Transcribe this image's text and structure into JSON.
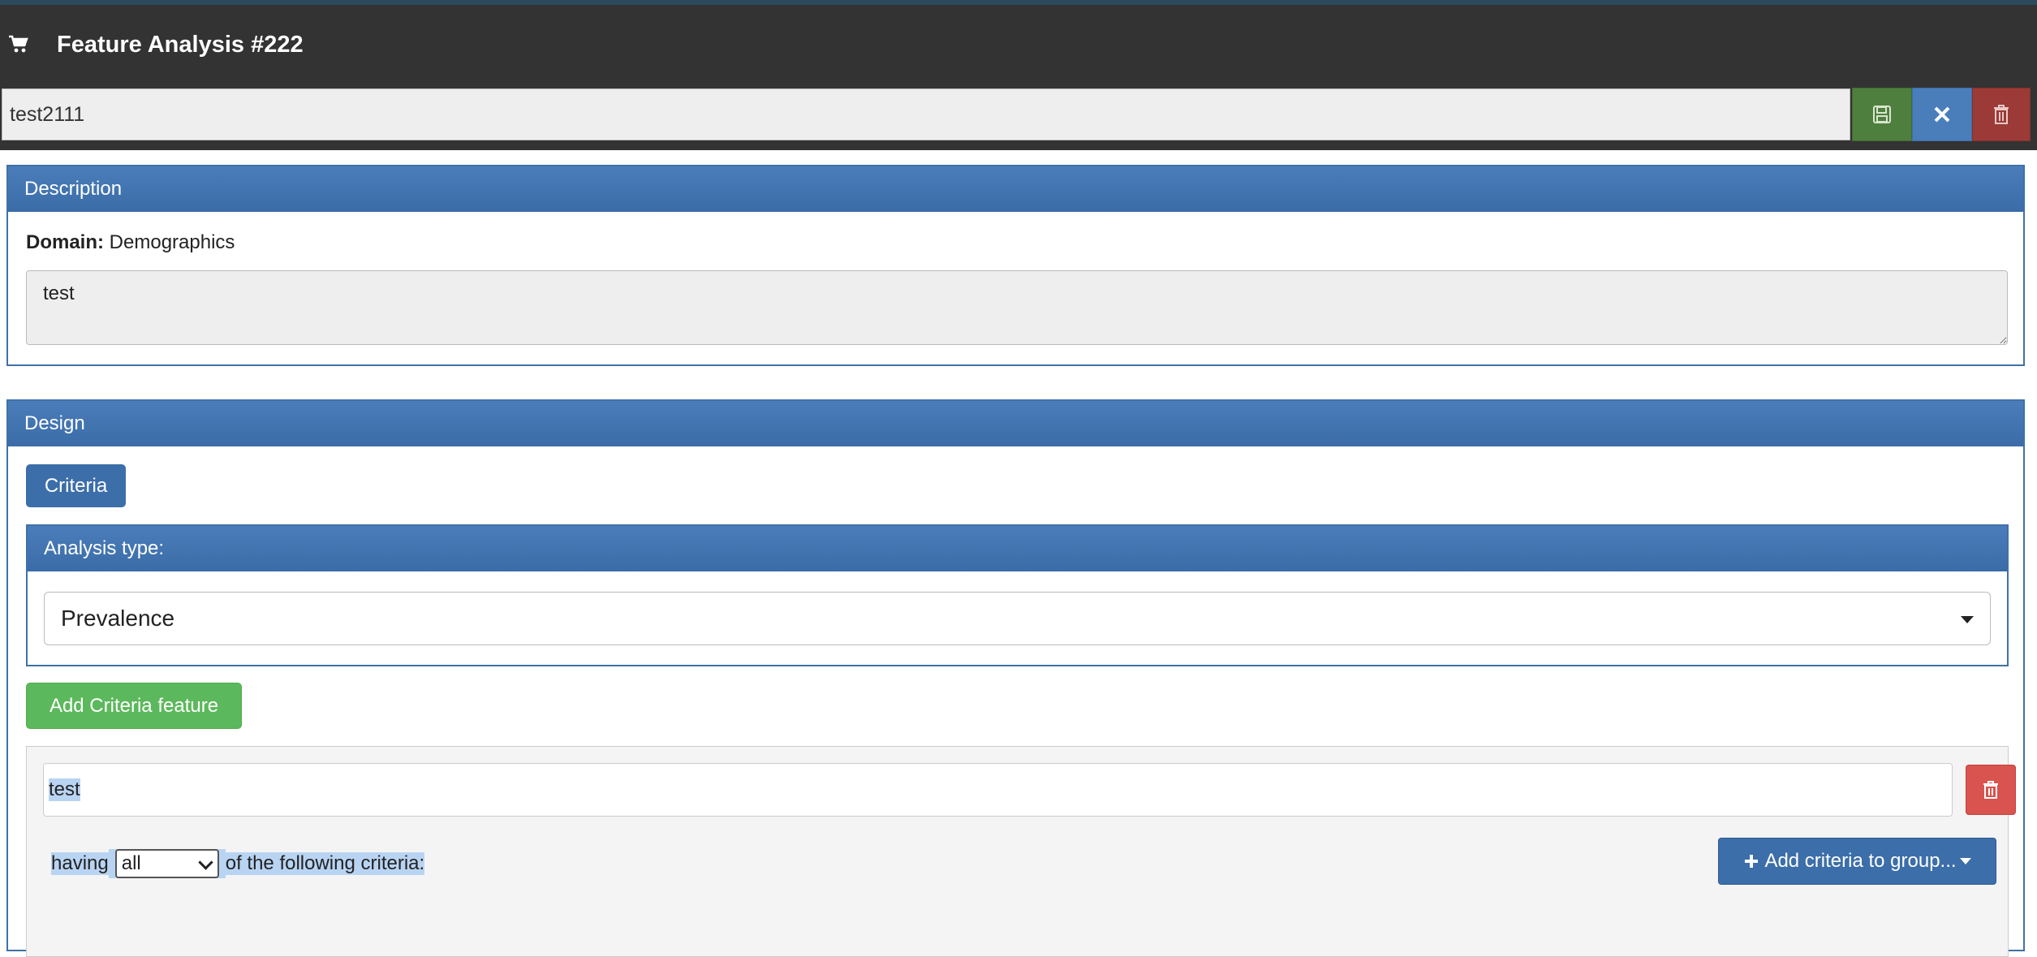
{
  "header": {
    "title": "Feature Analysis #222",
    "name_value": "test2111",
    "save_label": "save",
    "close_label": "close",
    "delete_label": "delete"
  },
  "description": {
    "heading": "Description",
    "domain_label": "Domain:",
    "domain_value": "Demographics",
    "text": "test"
  },
  "design": {
    "heading": "Design",
    "criteria_button": "Criteria",
    "analysis_type_label": "Analysis type:",
    "analysis_type_value": "Prevalence",
    "add_feature_button": "Add Criteria feature",
    "feature": {
      "name": "test",
      "having_prefix": "having",
      "match_value": "all",
      "having_suffix": "of the following criteria:",
      "add_group_button": "Add criteria to group..."
    }
  },
  "colors": {
    "header_bg": "#333333",
    "panel_blue": "#3f71a8",
    "save_green": "#4f7f3e",
    "delete_red": "#9b3a36",
    "add_green": "#5cb85c"
  },
  "icons": [
    "cart-icon",
    "floppy-icon",
    "close-icon",
    "trash-icon",
    "plus-icon"
  ]
}
